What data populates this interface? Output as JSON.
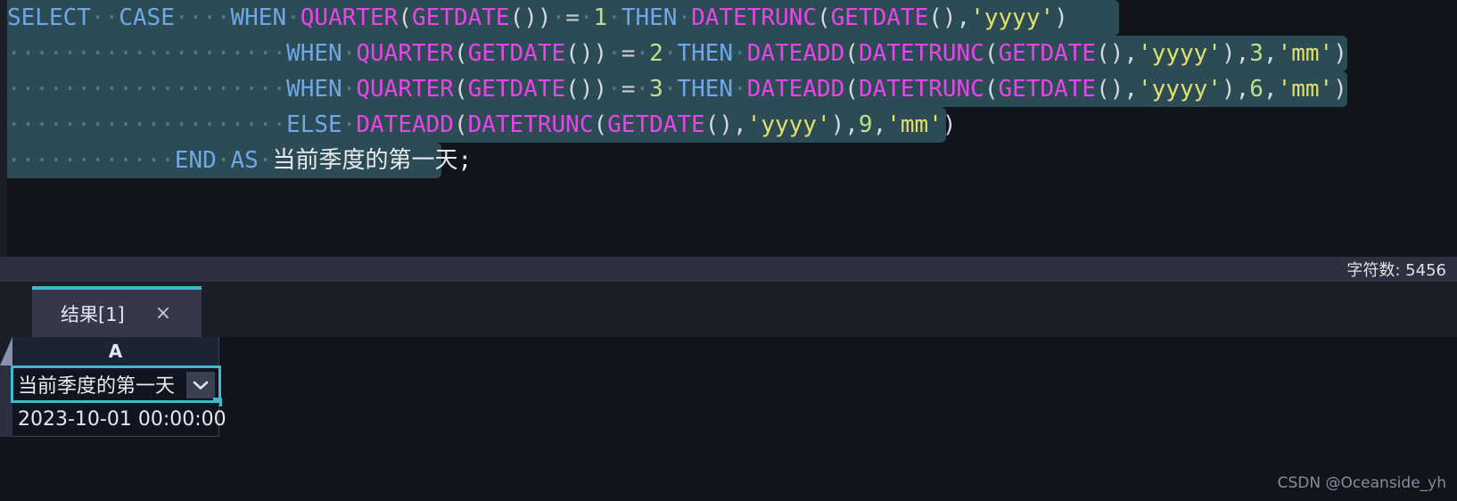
{
  "editor": {
    "language": "sql",
    "selection_color": "#2c4b55",
    "background": "#12141c",
    "lines": [
      {
        "n": 1,
        "sel_width": 1247,
        "tokens": [
          {
            "t": "SELECT",
            "c": "kw"
          },
          {
            "t": "··",
            "c": "ws"
          },
          {
            "t": "CASE",
            "c": "kw"
          },
          {
            "t": "····",
            "c": "ws"
          },
          {
            "t": "WHEN",
            "c": "kw"
          },
          {
            "t": "·",
            "c": "ws"
          },
          {
            "t": "QUARTER",
            "c": "fn"
          },
          {
            "t": "(",
            "c": "punc"
          },
          {
            "t": "GETDATE",
            "c": "fn"
          },
          {
            "t": "()",
            "c": "punc"
          },
          {
            "t": ")",
            "c": "punc"
          },
          {
            "t": "·",
            "c": "ws"
          },
          {
            "t": "=",
            "c": "op"
          },
          {
            "t": "·",
            "c": "ws"
          },
          {
            "t": "1",
            "c": "num"
          },
          {
            "t": "·",
            "c": "ws"
          },
          {
            "t": "THEN",
            "c": "kw"
          },
          {
            "t": "·",
            "c": "ws"
          },
          {
            "t": "DATETRUNC",
            "c": "fn"
          },
          {
            "t": "(",
            "c": "punc"
          },
          {
            "t": "GETDATE",
            "c": "fn"
          },
          {
            "t": "()",
            "c": "punc"
          },
          {
            "t": ",",
            "c": "punc"
          },
          {
            "t": "'yyyy'",
            "c": "str"
          },
          {
            "t": ")",
            "c": "punc"
          }
        ]
      },
      {
        "n": 2,
        "sel_width": 1503,
        "tokens": [
          {
            "t": "····················",
            "c": "ws"
          },
          {
            "t": "WHEN",
            "c": "kw"
          },
          {
            "t": "·",
            "c": "ws"
          },
          {
            "t": "QUARTER",
            "c": "fn"
          },
          {
            "t": "(",
            "c": "punc"
          },
          {
            "t": "GETDATE",
            "c": "fn"
          },
          {
            "t": "()",
            "c": "punc"
          },
          {
            "t": ")",
            "c": "punc"
          },
          {
            "t": "·",
            "c": "ws"
          },
          {
            "t": "=",
            "c": "op"
          },
          {
            "t": "·",
            "c": "ws"
          },
          {
            "t": "2",
            "c": "num"
          },
          {
            "t": "·",
            "c": "ws"
          },
          {
            "t": "THEN",
            "c": "kw"
          },
          {
            "t": "·",
            "c": "ws"
          },
          {
            "t": "DATEADD",
            "c": "fn"
          },
          {
            "t": "(",
            "c": "punc"
          },
          {
            "t": "DATETRUNC",
            "c": "fn"
          },
          {
            "t": "(",
            "c": "punc"
          },
          {
            "t": "GETDATE",
            "c": "fn"
          },
          {
            "t": "()",
            "c": "punc"
          },
          {
            "t": ",",
            "c": "punc"
          },
          {
            "t": "'yyyy'",
            "c": "str"
          },
          {
            "t": ")",
            "c": "punc"
          },
          {
            "t": ",",
            "c": "punc"
          },
          {
            "t": "3",
            "c": "num"
          },
          {
            "t": ",",
            "c": "punc"
          },
          {
            "t": "'mm'",
            "c": "str"
          },
          {
            "t": ")",
            "c": "punc"
          }
        ]
      },
      {
        "n": 3,
        "sel_width": 1503,
        "tokens": [
          {
            "t": "····················",
            "c": "ws"
          },
          {
            "t": "WHEN",
            "c": "kw"
          },
          {
            "t": "·",
            "c": "ws"
          },
          {
            "t": "QUARTER",
            "c": "fn"
          },
          {
            "t": "(",
            "c": "punc"
          },
          {
            "t": "GETDATE",
            "c": "fn"
          },
          {
            "t": "()",
            "c": "punc"
          },
          {
            "t": ")",
            "c": "punc"
          },
          {
            "t": "·",
            "c": "ws"
          },
          {
            "t": "=",
            "c": "op"
          },
          {
            "t": "·",
            "c": "ws"
          },
          {
            "t": "3",
            "c": "num"
          },
          {
            "t": "·",
            "c": "ws"
          },
          {
            "t": "THEN",
            "c": "kw"
          },
          {
            "t": "·",
            "c": "ws"
          },
          {
            "t": "DATEADD",
            "c": "fn"
          },
          {
            "t": "(",
            "c": "punc"
          },
          {
            "t": "DATETRUNC",
            "c": "fn"
          },
          {
            "t": "(",
            "c": "punc"
          },
          {
            "t": "GETDATE",
            "c": "fn"
          },
          {
            "t": "()",
            "c": "punc"
          },
          {
            "t": ",",
            "c": "punc"
          },
          {
            "t": "'yyyy'",
            "c": "str"
          },
          {
            "t": ")",
            "c": "punc"
          },
          {
            "t": ",",
            "c": "punc"
          },
          {
            "t": "6",
            "c": "num"
          },
          {
            "t": ",",
            "c": "punc"
          },
          {
            "t": "'mm'",
            "c": "str"
          },
          {
            "t": ")",
            "c": "punc"
          }
        ]
      },
      {
        "n": 4,
        "sel_width": 1053,
        "tokens": [
          {
            "t": "····················",
            "c": "ws"
          },
          {
            "t": "ELSE",
            "c": "kw"
          },
          {
            "t": "·",
            "c": "ws"
          },
          {
            "t": "DATEADD",
            "c": "fn"
          },
          {
            "t": "(",
            "c": "punc"
          },
          {
            "t": "DATETRUNC",
            "c": "fn"
          },
          {
            "t": "(",
            "c": "punc"
          },
          {
            "t": "GETDATE",
            "c": "fn"
          },
          {
            "t": "()",
            "c": "punc"
          },
          {
            "t": ",",
            "c": "punc"
          },
          {
            "t": "'yyyy'",
            "c": "str"
          },
          {
            "t": ")",
            "c": "punc"
          },
          {
            "t": ",",
            "c": "punc"
          },
          {
            "t": "9",
            "c": "num"
          },
          {
            "t": ",",
            "c": "punc"
          },
          {
            "t": "'mm'",
            "c": "str"
          },
          {
            "t": ")",
            "c": "punc"
          }
        ]
      },
      {
        "n": 5,
        "sel_width": 487,
        "tokens": [
          {
            "t": "············",
            "c": "ws"
          },
          {
            "t": "END",
            "c": "kw"
          },
          {
            "t": "·",
            "c": "ws"
          },
          {
            "t": "AS",
            "c": "kw"
          },
          {
            "t": "·",
            "c": "ws"
          },
          {
            "t": "当前季度的第一天;",
            "c": "txt"
          }
        ]
      }
    ],
    "indent_guides_x": [
      9,
      77,
      145,
      212
    ]
  },
  "statusbar": {
    "char_count_label": "字符数: 5456"
  },
  "bottom_panel": {
    "tab": {
      "label": "结果[1]",
      "close_icon": "×",
      "active_accent": "#41b8d0"
    },
    "grid": {
      "column_header": "A",
      "selected_cell_value": "当前季度的第一天",
      "dropdown_icon": "chevron-down-icon",
      "rows": [
        {
          "A": "2023-10-01 00:00:00"
        }
      ]
    }
  },
  "watermark": {
    "text": "CSDN @Oceanside_yh"
  }
}
